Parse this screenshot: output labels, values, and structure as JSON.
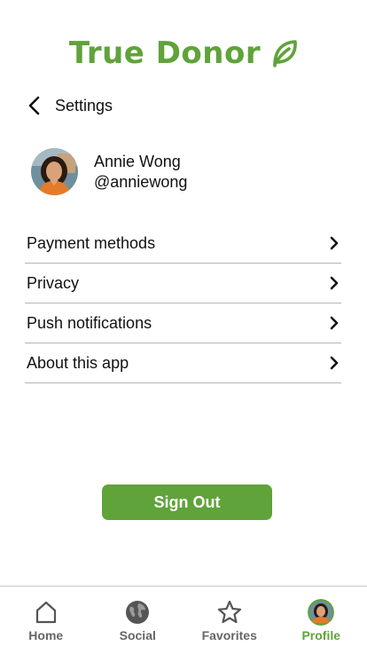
{
  "app": {
    "name": "True Donor"
  },
  "header": {
    "title": "Settings"
  },
  "user": {
    "name": "Annie Wong",
    "handle": "@anniewong"
  },
  "menu": [
    {
      "label": "Payment methods"
    },
    {
      "label": "Privacy"
    },
    {
      "label": "Push notifications"
    },
    {
      "label": "About this app"
    }
  ],
  "sign_out_label": "Sign Out",
  "tabs": [
    {
      "label": "Home",
      "icon": "home-icon"
    },
    {
      "label": "Social",
      "icon": "globe-icon"
    },
    {
      "label": "Favorites",
      "icon": "star-icon"
    },
    {
      "label": "Profile",
      "icon": "avatar",
      "active": true
    }
  ],
  "colors": {
    "accent": "#5fa33a",
    "divider": "#b5b5b5",
    "inactive_tab": "#666666"
  }
}
